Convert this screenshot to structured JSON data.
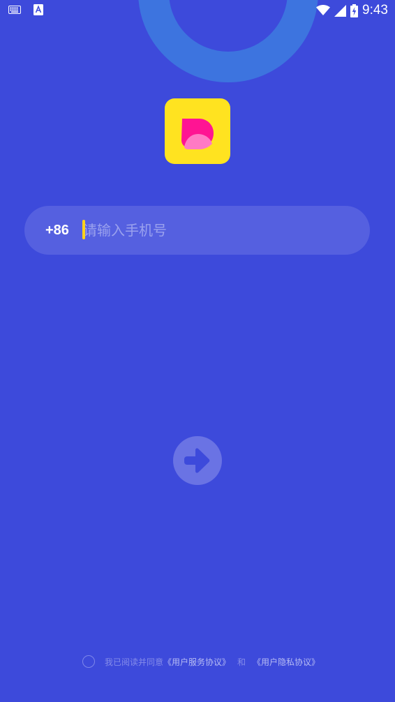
{
  "status_bar": {
    "time": "9:43",
    "left_icons": [
      "keyboard-icon",
      "font-a-icon"
    ],
    "right_icons": [
      "wifi-icon",
      "signal-icon",
      "battery-icon"
    ]
  },
  "login": {
    "country_code": "+86",
    "phone_placeholder": "请输入手机号",
    "phone_value": ""
  },
  "agreement": {
    "prefix": "我已阅读并同意",
    "service_link": "《用户服务协议》",
    "and": "和",
    "privacy_link": "《用户隐私协议》"
  },
  "colors": {
    "background": "#3d4adb",
    "logo_bg": "#ffe320",
    "logo_mark": "#ff1493",
    "ring": "#3d74df",
    "caret": "#ffd21c"
  }
}
